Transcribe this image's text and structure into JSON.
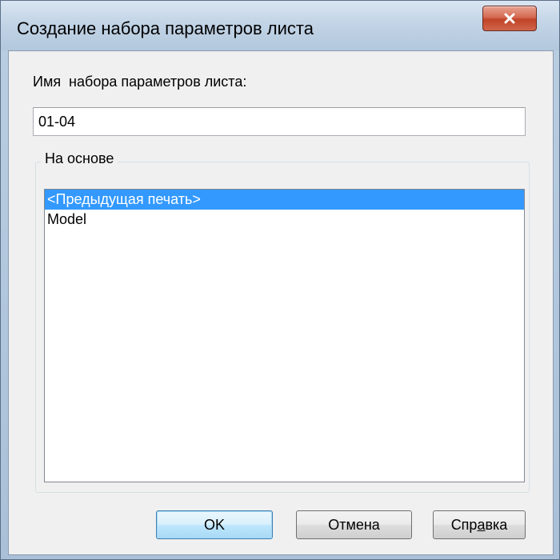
{
  "window": {
    "title": "Создание набора параметров листа"
  },
  "form": {
    "name_label": "Имя  набора параметров листа:",
    "name_value": "01-04",
    "based_on_legend": "На основе"
  },
  "list": {
    "items": [
      {
        "label": "<Предыдущая печать>",
        "selected": true
      },
      {
        "label": "Model",
        "selected": false
      }
    ]
  },
  "buttons": {
    "ok_label": "OK",
    "cancel_label": "Отмена",
    "help_label_pre": "Спр",
    "help_label_mnemonic": "а",
    "help_label_post": "вка"
  },
  "colors": {
    "selection": "#3399ff",
    "close_button": "#c14427",
    "dialog_background": "#f0f0f0"
  },
  "icons": {
    "close": "close-icon"
  }
}
